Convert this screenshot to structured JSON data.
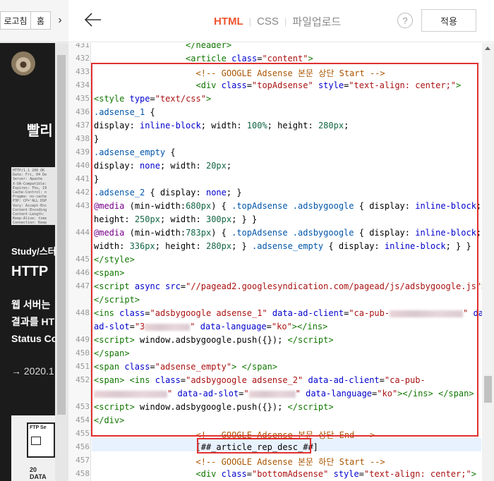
{
  "left": {
    "refresh_label": "로고침",
    "search_label": "홈"
  },
  "preview": {
    "title": "빨리",
    "http_thumb_text": "HTTP/1.1 200 OK\nDate: Fri, 04 De\nServer: Apache\nX-UA-Compatible:\nExpires: Thu, 19\nCache-Control: n\nPragma: no-cache\nP3P: CP='ALL DSP\nVary: Accept-Enc\nContent-Encoding\nContent-Length:\nKeep-Alive: time\nConnection: Keep\nContent-Type: te",
    "category": "Study/스터",
    "heading": "HTTP",
    "desc_1": "웹 서버는",
    "desc_2": "결과를 HT",
    "desc_3": "Status Co",
    "date": "→ 2020.1",
    "card_label": "FTP Se",
    "card_text_1": "20",
    "card_text_2": "DATA"
  },
  "header": {
    "tabs": [
      {
        "label": "HTML",
        "active": true
      },
      {
        "label": "CSS",
        "active": false
      },
      {
        "label": "파일업로드",
        "active": false
      }
    ],
    "help_label": "?",
    "apply_label": "적용"
  },
  "code": {
    "line_numbers": [
      "431",
      "432",
      "433",
      "434",
      "435",
      "436",
      "437",
      "438",
      "439",
      "440",
      "441",
      "442",
      "443",
      "",
      "444",
      "",
      "445",
      "446",
      "447",
      "",
      "448",
      "",
      "449",
      "450",
      "451",
      "452",
      "",
      "453",
      "454",
      "455",
      "456",
      "457",
      "458"
    ],
    "replace_token": "[##_article_rep_desc_##]"
  },
  "colors": {
    "accent": "#ee5530",
    "selection_border": "#e03030",
    "highlight_row": "#e8f2ff"
  }
}
